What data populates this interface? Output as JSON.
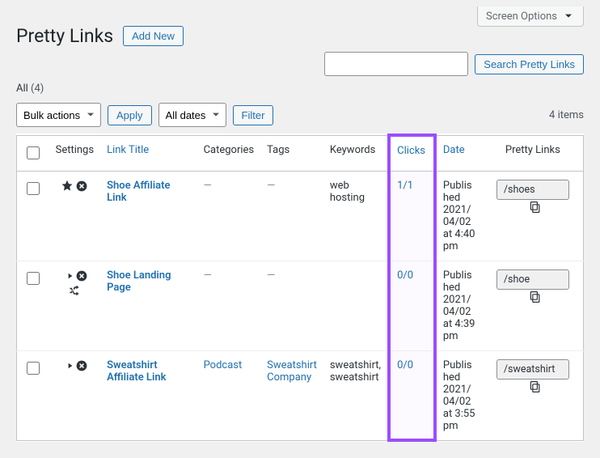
{
  "screen_options_label": "Screen Options",
  "page_title": "Pretty Links",
  "add_new_label": "Add New",
  "filter_tabs": {
    "all_label": "All",
    "all_count": "(4)"
  },
  "search_button_label": "Search Pretty Links",
  "bulk_actions_label": "Bulk actions",
  "apply_label": "Apply",
  "all_dates_label": "All dates",
  "filter_label": "Filter",
  "items_count_label": "4 items",
  "columns": {
    "settings": "Settings",
    "link_title": "Link Title",
    "categories": "Categories",
    "tags": "Tags",
    "keywords": "Keywords",
    "clicks": "Clicks",
    "date": "Date",
    "pretty": "Pretty Links"
  },
  "rows": [
    {
      "icons": [
        "star",
        "x"
      ],
      "title": "Shoe Affiliate Link",
      "categories": "—",
      "tags": "—",
      "keywords": "web hosting",
      "clicks": "1/1",
      "date": "Published 2021/04/02 at 4:40 pm",
      "slug": "/shoes"
    },
    {
      "icons": [
        "forward",
        "x",
        "shuffle"
      ],
      "title": "Shoe Landing Page",
      "categories": "—",
      "tags": "—",
      "keywords": "",
      "clicks": "0/0",
      "date": "Published 2021/04/02 at 4:39 pm",
      "slug": "/shoe"
    },
    {
      "icons": [
        "forward",
        "x"
      ],
      "title": "Sweatshirt Affiliate Link",
      "categories": "Podcast",
      "cat_link": true,
      "tags": "Sweatshirt Company",
      "tags_link": true,
      "keywords": "sweatshirt, sweatshirt",
      "clicks": "0/0",
      "date": "Published 2021/04/02 at 3:55 pm",
      "slug": "/sweatshirt"
    }
  ]
}
